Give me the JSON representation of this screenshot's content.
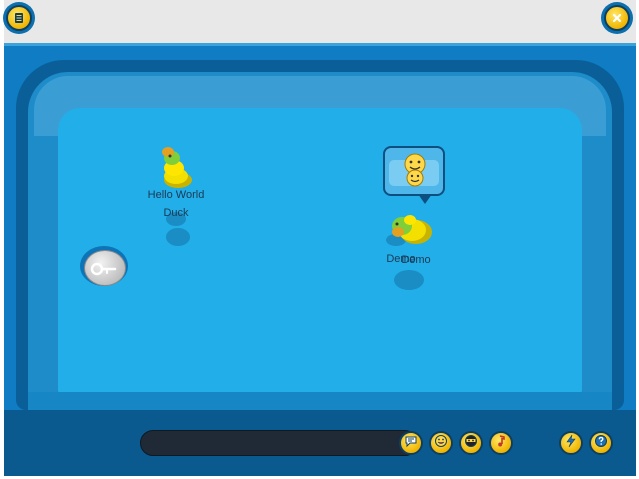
{
  "game": {
    "players": [
      {
        "username": "Hello World",
        "nickname": "Duck"
      },
      {
        "username": "Demo",
        "nickname": "Demo"
      }
    ],
    "chat": {
      "value": ""
    }
  },
  "toolbar": {
    "left_icons": [
      "chat-bubble-icon",
      "emote-face-icon",
      "ninja-face-icon",
      "music-note-icon"
    ],
    "right_icons": [
      "lightning-icon",
      "help-icon"
    ]
  },
  "corner_buttons": {
    "left_icon": "menu-icon",
    "right_icon": "close-icon"
  },
  "colors": {
    "frame": "#0f7cc4",
    "water": "#22aee8",
    "button_yellow": "#f1b500",
    "bar": "#0b5a8f"
  }
}
